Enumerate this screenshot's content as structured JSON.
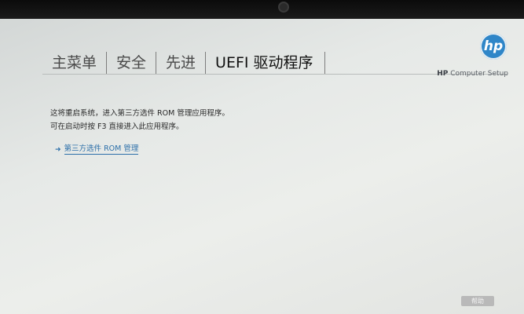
{
  "tabs": [
    {
      "label": "主菜单",
      "active": false
    },
    {
      "label": "安全",
      "active": false
    },
    {
      "label": "先进",
      "active": false
    },
    {
      "label": "UEFI 驱动程序",
      "active": true
    }
  ],
  "brand": {
    "logo": "hp",
    "product_bold": "HP",
    "product_rest": " Computer Setup"
  },
  "message": {
    "line1": "这将重启系统，进入第三方选件 ROM 管理应用程序。",
    "line2": "可在启动时按 F3 直接进入此应用程序。"
  },
  "link": {
    "label": "第三方选件 ROM 管理",
    "icon": "arrow-right-icon"
  },
  "footer": {
    "help_label": "帮助"
  },
  "colors": {
    "logo": "#2f86c8",
    "link": "#2c6fa9"
  }
}
